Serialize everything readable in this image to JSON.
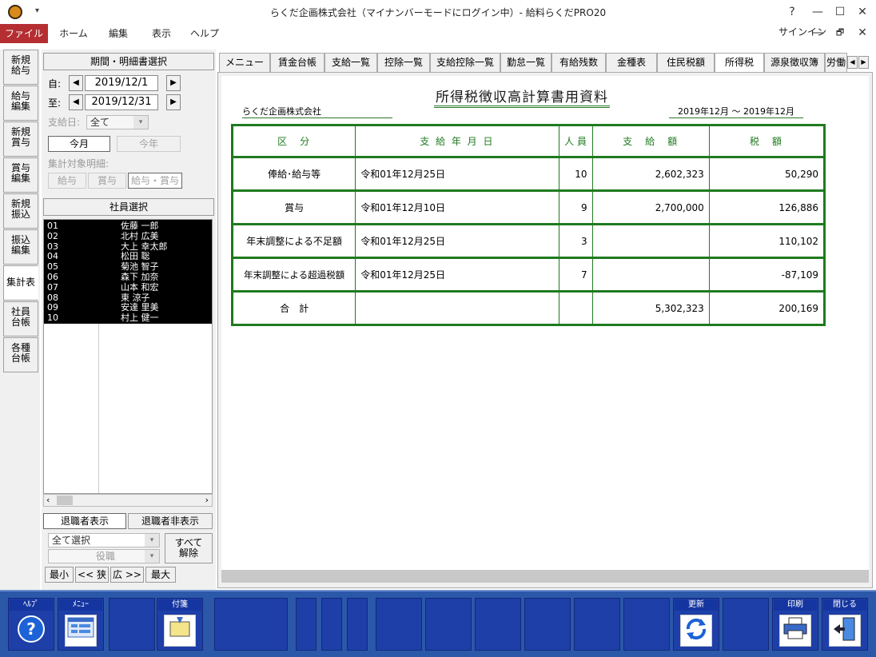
{
  "window": {
    "title": "らくだ企画株式会社（マイナンバーモードにログイン中）- 給料らくだPRO20",
    "help": "?",
    "minimize": "—",
    "maximize": "☐",
    "close": "✕",
    "restore": "🗗"
  },
  "menubar": {
    "file": "ファイル",
    "items": [
      "ホーム",
      "編集",
      "表示",
      "ヘルプ"
    ],
    "signin": "サインイン"
  },
  "lefttabs": [
    {
      "label": "新規\n給与"
    },
    {
      "label": "給与\n編集"
    },
    {
      "label": "新規\n賞与"
    },
    {
      "label": "賞与\n編集"
    },
    {
      "label": "新規\n振込"
    },
    {
      "label": "振込\n編集"
    },
    {
      "label": "集計表"
    },
    {
      "label": "社員\n台帳"
    },
    {
      "label": "各種\n台帳"
    }
  ],
  "period": {
    "header": "期間・明細書選択",
    "from_label": "自:",
    "from_date": "2019/12/1",
    "to_label": "至:",
    "to_date": "2019/12/31",
    "payday_label": "支給日:",
    "payday_value": "全て",
    "this_month": "今月",
    "this_year": "今年",
    "detail_label": "集計対象明細:",
    "detail_options": [
      "給与",
      "賞与",
      "給与・賞与"
    ]
  },
  "employees": {
    "header": "社員選択",
    "list": [
      {
        "code": "01",
        "name": "佐藤 一郎"
      },
      {
        "code": "02",
        "name": "北村 広美"
      },
      {
        "code": "03",
        "name": "大上 幸太郎"
      },
      {
        "code": "04",
        "name": "松田 聡"
      },
      {
        "code": "05",
        "name": "菊池 智子"
      },
      {
        "code": "06",
        "name": "森下 加奈"
      },
      {
        "code": "07",
        "name": "山本 和宏"
      },
      {
        "code": "08",
        "name": "東 涼子"
      },
      {
        "code": "09",
        "name": "安達 里美"
      },
      {
        "code": "10",
        "name": "村上 健一"
      }
    ],
    "show_retired": "退職者表示",
    "hide_retired": "退職者非表示",
    "select_all": "全て選択",
    "position": "役職",
    "clear_all": "すべて\n解除",
    "zoom": [
      "最小",
      "<< 狭",
      "広 >>",
      "最大"
    ]
  },
  "tabs": [
    "メニュー",
    "賃金台帳",
    "支給一覧",
    "控除一覧",
    "支給控除一覧",
    "勤怠一覧",
    "有給残数",
    "金種表",
    "住民税額",
    "所得税",
    "源泉徴収簿",
    "労働"
  ],
  "active_tab": "所得税",
  "report": {
    "title": "所得税徴収高計算書用資料",
    "company": "らくだ企画株式会社",
    "period": "2019年12月 〜 2019年12月",
    "headers": [
      "区　分",
      "支 給 年 月 日",
      "人 員",
      "支　給　額",
      "税　額"
    ],
    "rows": [
      {
        "kubun": "俸給･給与等",
        "date": "令和01年12月25日",
        "count": "10",
        "amount": "2,602,323",
        "tax": "50,290"
      },
      {
        "kubun": "賞与",
        "date": "令和01年12月10日",
        "count": "9",
        "amount": "2,700,000",
        "tax": "126,886"
      },
      {
        "kubun": "年末調整による不足額",
        "date": "令和01年12月25日",
        "count": "3",
        "amount": "",
        "tax": "110,102"
      },
      {
        "kubun": "年末調整による超過税額",
        "date": "令和01年12月25日",
        "count": "7",
        "amount": "",
        "tax": "-87,109"
      }
    ],
    "total": {
      "label": "合　計",
      "date": "",
      "count": "",
      "amount": "5,302,323",
      "tax": "200,169"
    }
  },
  "toolbar": {
    "help": "ﾍﾙﾌﾟ",
    "menu": "ﾒﾆｭｰ",
    "note": "付箋",
    "update": "更新",
    "print": "印刷",
    "close": "閉じる"
  }
}
